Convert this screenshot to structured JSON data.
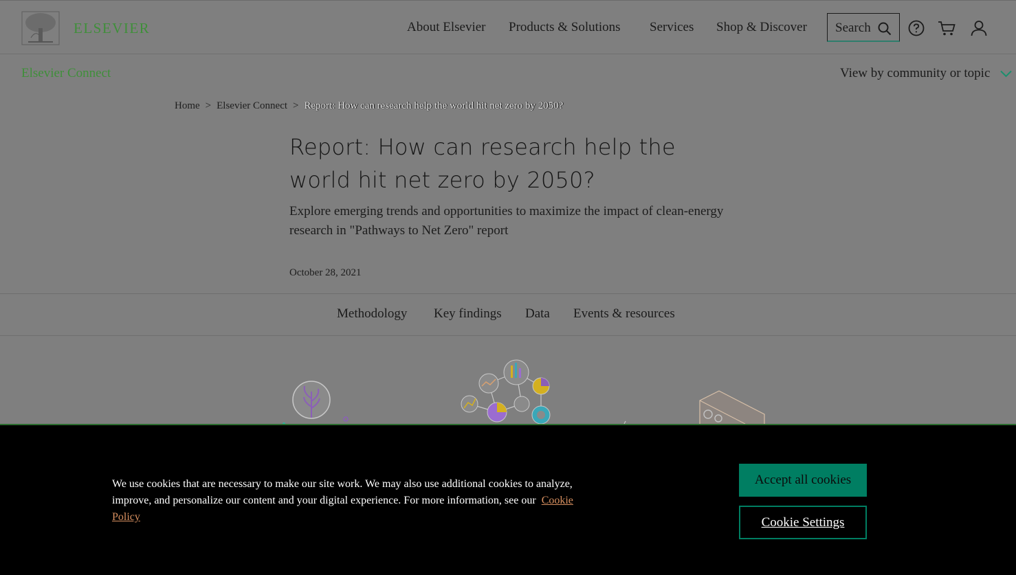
{
  "header": {
    "wordmark": "ELSEVIER",
    "nav": [
      "About Elsevier",
      "Products & Solutions",
      "Services",
      "Shop & Discover"
    ],
    "search_label": "Search",
    "icons": [
      "search-icon",
      "help-icon",
      "cart-icon",
      "user-icon"
    ]
  },
  "subnav": {
    "connect": "Elsevier Connect",
    "view_by": "View by community or topic"
  },
  "breadcrumb": {
    "home": "Home",
    "sep": ">",
    "connect": "Elsevier Connect",
    "current": "Report: How can research help the world hit net zero by 2050?"
  },
  "article": {
    "title": "Report: How can research help the world hit net zero by 2050?",
    "subtitle": "Explore emerging trends and opportunities to maximize the impact of clean-energy research in \"Pathways to Net Zero\" report",
    "date": "October 28, 2021"
  },
  "tabs": [
    "Methodology",
    "Key findings",
    "Data",
    "Events & resources"
  ],
  "cookie": {
    "text": "We use cookies that are necessary to make our site work. We may also use additional cookies to analyze, improve, and personalize our content and your digital experience. For more information, see our",
    "link": "Cookie Policy",
    "accept": "Accept all cookies",
    "settings": "Cookie Settings"
  },
  "colors": {
    "brand_green": "#3f8f3a",
    "button_teal": "#007e62",
    "overlay_gray": "#7f7f7f"
  }
}
